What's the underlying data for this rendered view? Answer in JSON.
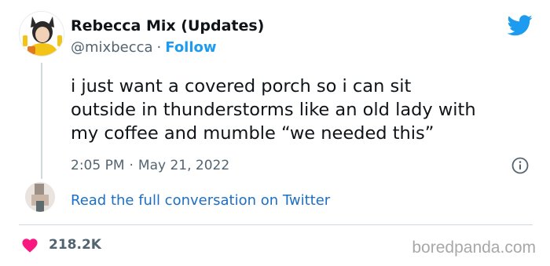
{
  "author": {
    "name": "Rebecca Mix (Updates)",
    "handle": "@mixbecca",
    "separator": "·",
    "follow_label": "Follow"
  },
  "tweet": {
    "lines": [
      "i just want a covered porch so i can sit",
      "outside in thunderstorms like an old lady with",
      "my coffee and mumble “we needed this”"
    ],
    "time": "2:05 PM",
    "separator": "·",
    "date": "May 21, 2022"
  },
  "conversation": {
    "link_label": "Read the full conversation on Twitter"
  },
  "stats": {
    "likes": "218.2K"
  },
  "watermark": "boredpanda.com",
  "colors": {
    "accent": "#1d9bf0",
    "link": "#1d6fc4",
    "heart": "#f91880",
    "muted": "#536471"
  },
  "icons": {
    "brand": "twitter-bird-icon",
    "info": "info-icon",
    "like": "heart-icon"
  }
}
